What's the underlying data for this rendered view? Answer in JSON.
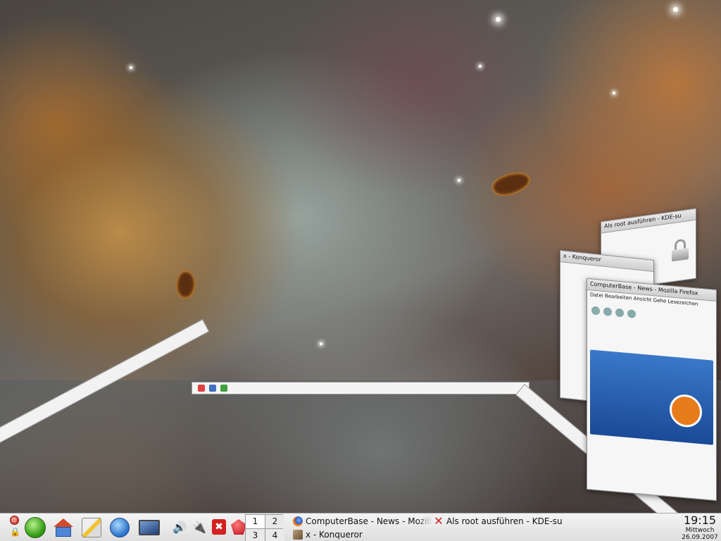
{
  "desktop": {
    "wallpaper": "nebula",
    "accent": "#c98a3a"
  },
  "windows": {
    "kdesu_title": "Als root ausführen - KDE-su",
    "konqueror_title": "x - Konqueror",
    "mozilla_title": "ComputerBase - News - Mozilla Firefox",
    "mozilla_menu": "Datei  Bearbeiten  Ansicht  Gehe  Lesezeichen",
    "mozilla_logo": "ComputerBase"
  },
  "panel": {
    "launchers": [
      {
        "name": "suse-menu-icon"
      },
      {
        "name": "home-folder-icon"
      },
      {
        "name": "text-editor-icon"
      },
      {
        "name": "konqueror-globe-icon"
      },
      {
        "name": "desktop-screen-icon"
      }
    ],
    "tray": {
      "volume_glyph": "🔊",
      "network_glyph": "🔌",
      "korganizer_glyph": "✖"
    },
    "pager": {
      "desktops": [
        "1",
        "2",
        "3",
        "4"
      ],
      "active": "1"
    },
    "tasks": [
      {
        "label": "ComputerBase - News - Mozilla Firefox",
        "icon": "firefox-icon"
      },
      {
        "label": "Als root ausführen - KDE-su",
        "icon": "kdesu-x-icon"
      },
      {
        "label": "x - Konqueror",
        "icon": "konqueror-icon"
      }
    ],
    "clock": {
      "time": "19:15",
      "weekday": "Mittwoch",
      "date": "26.09.2007"
    }
  }
}
